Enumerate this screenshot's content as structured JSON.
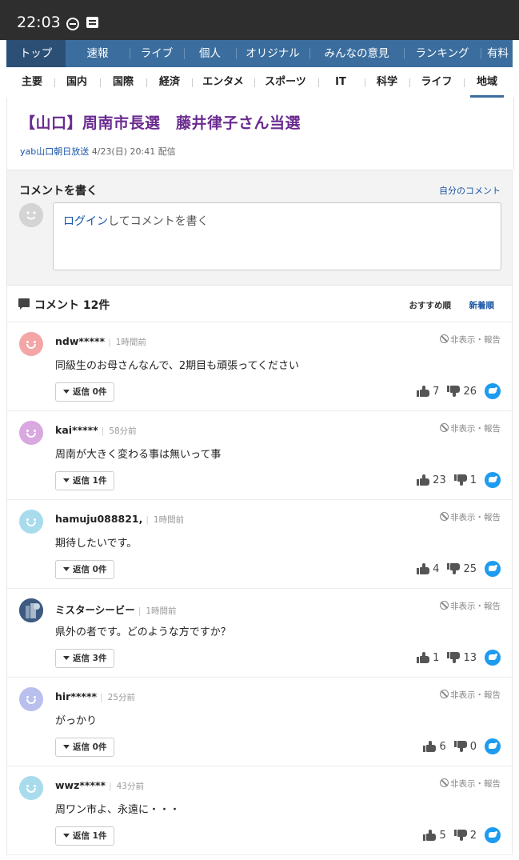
{
  "status_bar": {
    "time": "22:03"
  },
  "top_nav": {
    "tabs": [
      {
        "label": "トップ",
        "active": true
      },
      {
        "label": "速報"
      },
      {
        "label": "ライブ"
      },
      {
        "label": "個人"
      },
      {
        "label": "オリジナル"
      },
      {
        "label": "みんなの意見"
      },
      {
        "label": "ランキング"
      },
      {
        "label": "有料"
      }
    ]
  },
  "sub_nav": {
    "items": [
      {
        "label": "主要"
      },
      {
        "label": "国内"
      },
      {
        "label": "国際"
      },
      {
        "label": "経済"
      },
      {
        "label": "エンタメ"
      },
      {
        "label": "スポーツ"
      },
      {
        "label": "IT"
      },
      {
        "label": "科学"
      },
      {
        "label": "ライフ"
      },
      {
        "label": "地域",
        "active": true
      }
    ]
  },
  "article": {
    "title": "【山口】周南市長選　藤井律子さん当選",
    "source": "yab山口朝日放送",
    "datetime": "4/23(日) 20:41",
    "delivered": "配信"
  },
  "compose": {
    "heading": "コメントを書く",
    "my_comments": "自分のコメント",
    "login_link": "ログイン",
    "placeholder_rest": "してコメントを書く"
  },
  "comments_section": {
    "count_label": "コメント 12件",
    "sort_recommended": "おすすめ順",
    "sort_newest": "新着順"
  },
  "comment_ui": {
    "report_label": "非表示・報告"
  },
  "comments": [
    {
      "user": "ndw*****",
      "time": "1時間前",
      "text": "同級生のお母さんなんで、2期目も頑張ってください",
      "replies": "返信 0件",
      "likes": "7",
      "dislikes": "26",
      "avatar_color": "#f4a6a6"
    },
    {
      "user": "kai*****",
      "time": "58分前",
      "text": "周南が大きく変わる事は無いって事",
      "replies": "返信 1件",
      "likes": "23",
      "dislikes": "1",
      "avatar_color": "#d9a8e0"
    },
    {
      "user": "hamuju088821,",
      "time": "1時間前",
      "text": "期待したいです。",
      "replies": "返信 0件",
      "likes": "4",
      "dislikes": "25",
      "avatar_color": "#a8dcec"
    },
    {
      "user": "ミスターシービー",
      "time": "1時間前",
      "text": "県外の者です。どのような方ですか？",
      "replies": "返信 3件",
      "likes": "1",
      "dislikes": "13",
      "avatar_color": "#3d5a80",
      "photo": true
    },
    {
      "user": "hir*****",
      "time": "25分前",
      "text": "がっかり",
      "replies": "返信 0件",
      "likes": "6",
      "dislikes": "0",
      "avatar_color": "#b9c0ee"
    },
    {
      "user": "wwz*****",
      "time": "43分前",
      "text": "周ワン市よ、永遠に・・・",
      "replies": "返信 1件",
      "likes": "5",
      "dislikes": "2",
      "avatar_color": "#a8dcec"
    }
  ]
}
